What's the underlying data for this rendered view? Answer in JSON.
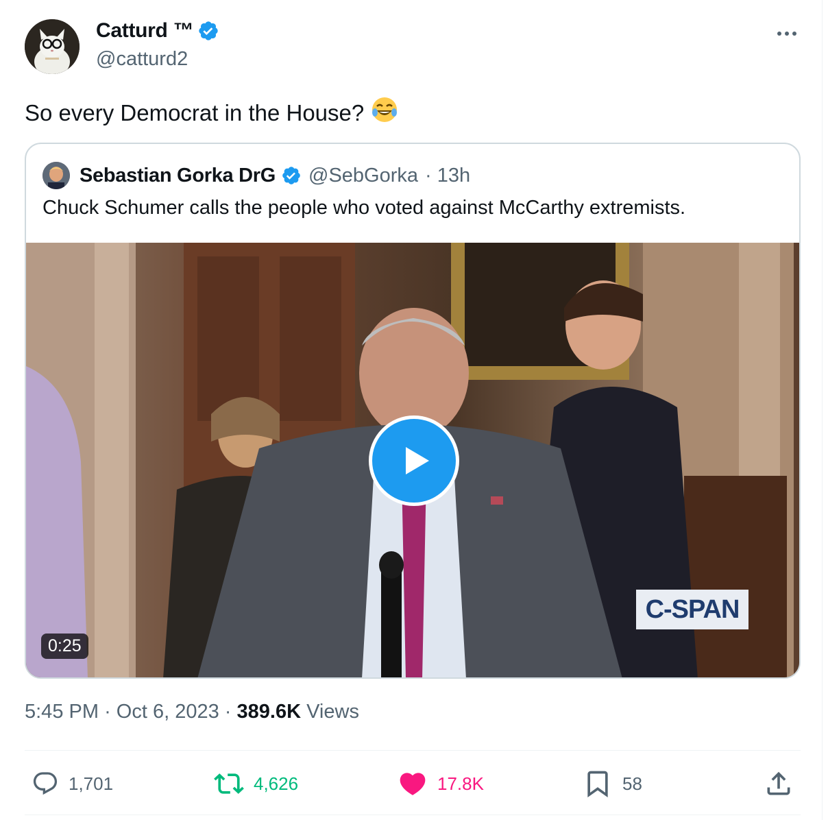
{
  "author": {
    "name": "Catturd ™",
    "handle": "@catturd2"
  },
  "tweet": {
    "text": "So every Democrat in the House?",
    "emoji": "😂"
  },
  "quote": {
    "name": "Sebastian Gorka DrG",
    "handle": "@SebGorka",
    "time": "· 13h",
    "text": "Chuck Schumer calls the people who voted against McCarthy extremists.",
    "video": {
      "duration": "0:25",
      "watermark": "C-SPAN"
    }
  },
  "meta": {
    "time": "5:45 PM",
    "date": "Oct 6, 2023",
    "views_count": "389.6K",
    "views_label": "Views",
    "sep": "·"
  },
  "actions": {
    "replies": "1,701",
    "reposts": "4,626",
    "likes": "17.8K",
    "bookmarks": "58"
  },
  "colors": {
    "verified": "#1d9bf0",
    "repost": "#00ba7c",
    "like": "#f91880",
    "muted": "#536471"
  }
}
